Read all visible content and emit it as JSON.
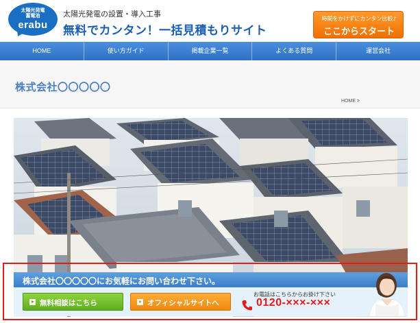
{
  "header": {
    "logo_sub": "太陽光発電\n蓄電池",
    "logo_main": "erabu",
    "tagline": "太陽光発電の設置・導入工事",
    "site_title": "無料でカンタン！一括見積もりサイト",
    "cta_sub": "時間をかけずにカンタン比較♪",
    "cta_main": "ここからスタート"
  },
  "nav": {
    "items": [
      "HOME",
      "使い方ガイド",
      "掲載企業一覧",
      "よくある質問",
      "運営会社"
    ]
  },
  "page": {
    "company_heading": "株式会社〇〇〇〇〇",
    "breadcrumb": "HOME >"
  },
  "contact": {
    "heading": "株式会社〇〇〇〇〇にお気軽にお問い合わせ下さい。",
    "consult_button": "無料相談はこちら",
    "official_button": "オフィシャルサイトへ",
    "phone_note": "お電話はこちらからお掛け下さい",
    "phone_number": "0120-×××-×××"
  },
  "colors": {
    "brand_blue": "#1a6fc4",
    "nav_blue": "#2f71c4",
    "cta_orange": "#f07000",
    "highlight_red": "#e8191a",
    "consult_green": "#5fae1f"
  },
  "icons": [
    "phone-icon",
    "arrow-icon"
  ]
}
